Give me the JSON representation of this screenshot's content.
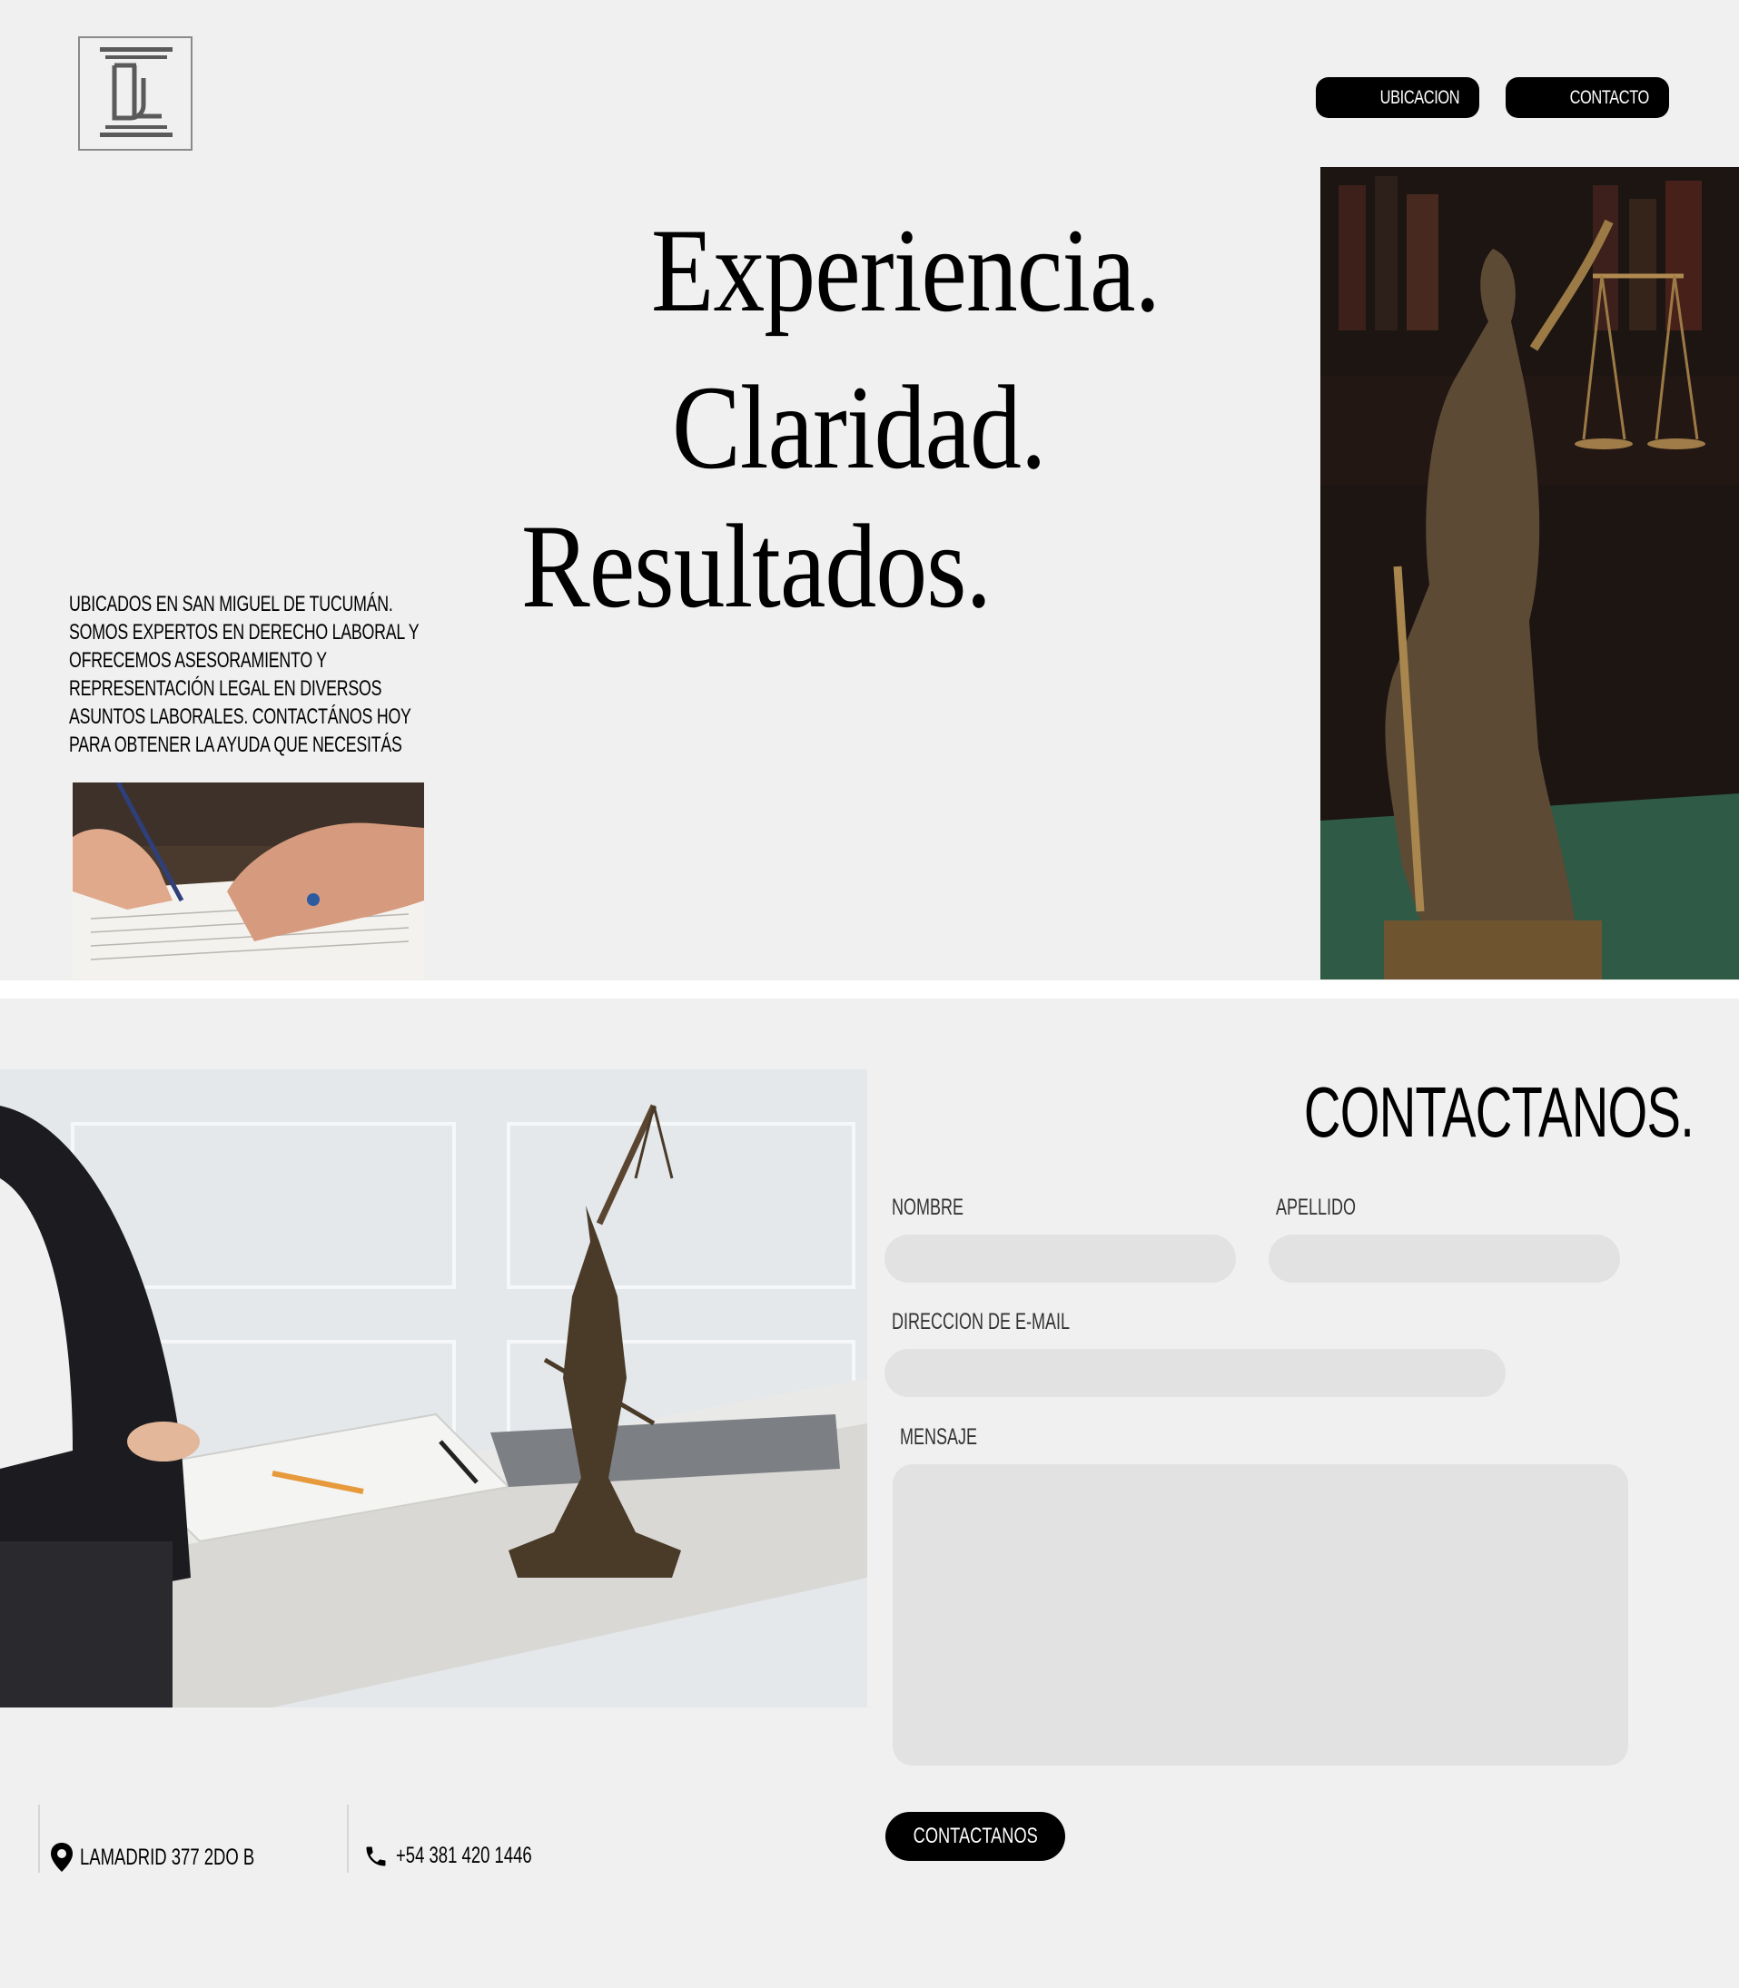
{
  "nav": {
    "ubicacion_label": "UBICACION",
    "contacto_label": "CONTACTO"
  },
  "hero": {
    "headline_1": "Experiencia.",
    "headline_2": "Claridad.",
    "headline_3": "Resultados.",
    "intro": "UBICADOS EN SAN MIGUEL DE TUCUMÁN. SOMOS EXPERTOS EN DERECHO LABORAL Y OFRECEMOS ASESORAMIENTO Y REPRESENTACIÓN LEGAL EN DIVERSOS ASUNTOS LABORALES. CONTACTÁNOS HOY PARA OBTENER LA AYUDA QUE NECESITÁS"
  },
  "contact": {
    "title": "CONTACTANOS.",
    "nombre_label": "NOMBRE",
    "apellido_label": "APELLIDO",
    "email_label": "DIRECCION DE E-MAIL",
    "mensaje_label": "MENSAJE",
    "nombre_value": "",
    "apellido_value": "",
    "email_value": "",
    "mensaje_value": "",
    "submit_label": "CONTACTANOS"
  },
  "footer": {
    "address": "LAMADRID 377 2DO B",
    "phone": "+54 381 420 1446"
  },
  "icons": {
    "logo": "pillar-logo-icon",
    "address": "map-pin-icon",
    "phone": "phone-icon"
  },
  "colors": {
    "background": "#f0f0f0",
    "button": "#000000",
    "field": "#e2e2e2"
  }
}
